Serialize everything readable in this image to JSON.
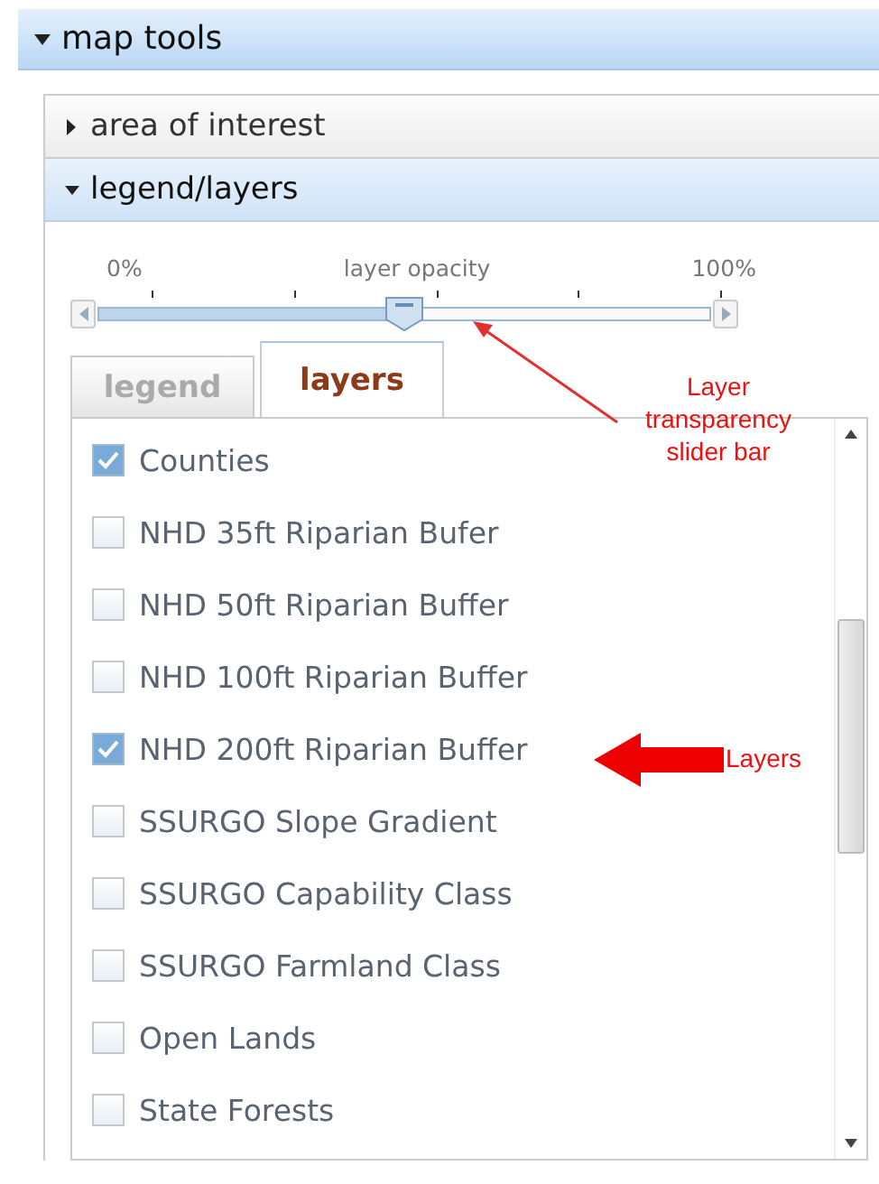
{
  "header": {
    "title": "map tools",
    "expanded": true
  },
  "sections": [
    {
      "title": "area of interest",
      "expanded": false
    },
    {
      "title": "legend/layers",
      "expanded": true
    }
  ],
  "opacity_slider": {
    "min_label": "0%",
    "label": "layer opacity",
    "max_label": "100%",
    "level": 0.5
  },
  "tabs": [
    {
      "label": "legend",
      "selected": false
    },
    {
      "label": "layers",
      "selected": true
    }
  ],
  "layers": [
    {
      "name": "Counties",
      "checked": true
    },
    {
      "name": "NHD 35ft Riparian Bufer",
      "checked": false
    },
    {
      "name": "NHD 50ft Riparian Buffer",
      "checked": false
    },
    {
      "name": "NHD 100ft Riparian Buffer",
      "checked": false
    },
    {
      "name": "NHD 200ft Riparian Buffer",
      "checked": true
    },
    {
      "name": "SSURGO Slope Gradient",
      "checked": false
    },
    {
      "name": "SSURGO Capability Class",
      "checked": false
    },
    {
      "name": "SSURGO Farmland Class",
      "checked": false
    },
    {
      "name": "Open Lands",
      "checked": false
    },
    {
      "name": "State Forests",
      "checked": false
    }
  ],
  "annotations": [
    {
      "kind": "thin",
      "text": "Layer transparency slider bar"
    },
    {
      "kind": "bold",
      "text": "Layers"
    }
  ]
}
